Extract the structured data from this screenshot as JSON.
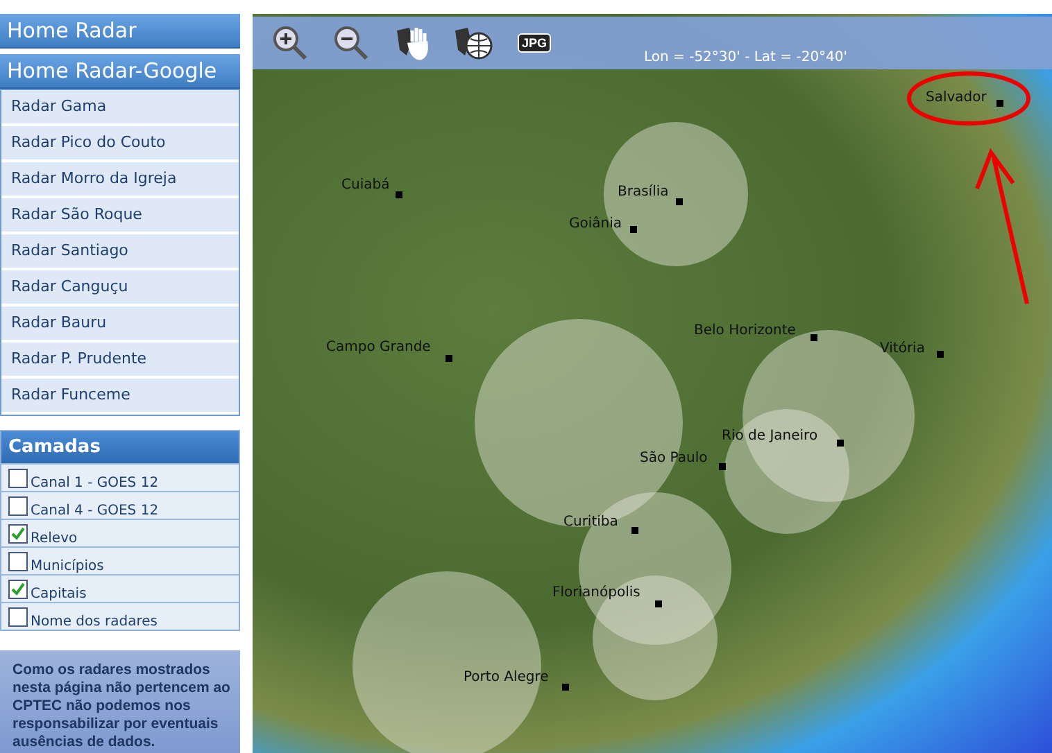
{
  "menu_headers": [
    "Home Radar",
    "Home Radar-Google"
  ],
  "radar_links": [
    "Radar Gama",
    "Radar Pico do Couto",
    "Radar Morro da Igreja",
    "Radar São Roque",
    "Radar Santiago",
    "Radar Canguçu",
    "Radar Bauru",
    "Radar P. Prudente",
    "Radar Funceme"
  ],
  "layers": {
    "title": "Camadas",
    "items": [
      {
        "label": "Canal 1 - GOES 12",
        "checked": false
      },
      {
        "label": "Canal 4 - GOES 12",
        "checked": false
      },
      {
        "label": "Relevo",
        "checked": true
      },
      {
        "label": "Municípios",
        "checked": false
      },
      {
        "label": "Capitais",
        "checked": true
      },
      {
        "label": "Nome dos radares",
        "checked": false
      }
    ]
  },
  "notice": "Como os radares mostrados nesta página não pertencem ao CPTEC não podemos nos responsabilizar por eventuais ausências de dados.",
  "toolbar": {
    "coordinates": "Lon = -52°30' - Lat = -20°40'",
    "jpg_label": "JPG"
  },
  "map": {
    "cities": [
      {
        "name": "Salvador"
      },
      {
        "name": "Cuiabá"
      },
      {
        "name": "Brasília"
      },
      {
        "name": "Goiânia"
      },
      {
        "name": "Campo Grande"
      },
      {
        "name": "Belo Horizonte"
      },
      {
        "name": "Vitória"
      },
      {
        "name": "Rio de Janeiro"
      },
      {
        "name": "São Paulo"
      },
      {
        "name": "Curitiba"
      },
      {
        "name": "Florianópolis"
      },
      {
        "name": "Porto Alegre"
      }
    ]
  }
}
